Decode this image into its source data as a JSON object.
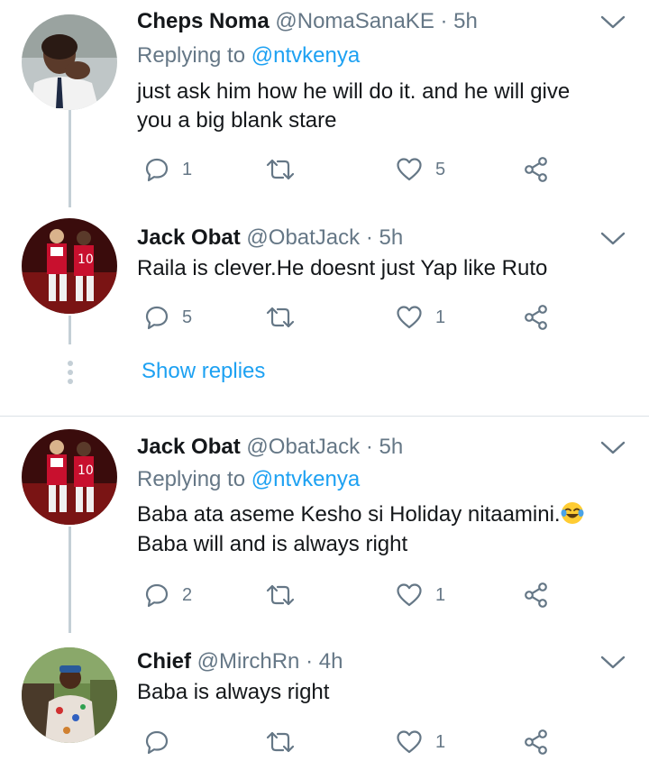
{
  "tweets": [
    {
      "name": "Cheps Noma",
      "handle": "@NomaSanaKE",
      "sep": "·",
      "time": "5h",
      "replying_prefix": "Replying to ",
      "replying_mention": "@ntvkenya",
      "lines": [
        "just ask him how he will do it. and he will give",
        "you a big blank stare"
      ],
      "replies": "1",
      "retweets": "",
      "likes": "5"
    },
    {
      "name": "Jack Obat",
      "handle": "@ObatJack",
      "sep": "·",
      "time": "5h",
      "lines": [
        "Raila is clever.He doesnt just Yap like Ruto"
      ],
      "replies": "5",
      "retweets": "",
      "likes": "1"
    },
    {
      "name": "Jack Obat",
      "handle": "@ObatJack",
      "sep": "·",
      "time": "5h",
      "replying_prefix": "Replying to ",
      "replying_mention": "@ntvkenya",
      "lines": [
        "Baba ata aseme Kesho si Holiday nitaamini.",
        "Baba will and is always right"
      ],
      "emoji": "tears-of-joy-emoji",
      "replies": "2",
      "retweets": "",
      "likes": "1"
    },
    {
      "name": "Chief",
      "handle": "@MirchRn",
      "sep": "·",
      "time": "4h",
      "lines": [
        "Baba is always right"
      ],
      "replies": "",
      "retweets": "",
      "likes": "1"
    }
  ],
  "show_replies": "Show replies",
  "icons": {
    "reply": "reply-icon",
    "retweet": "retweet-icon",
    "like": "heart-icon",
    "share": "share-icon",
    "more": "chevron-down-icon"
  },
  "colors": {
    "link": "#1da1f2",
    "secondary_text": "#657786",
    "icon": "#657786",
    "thread_line": "#c4cfd6"
  }
}
